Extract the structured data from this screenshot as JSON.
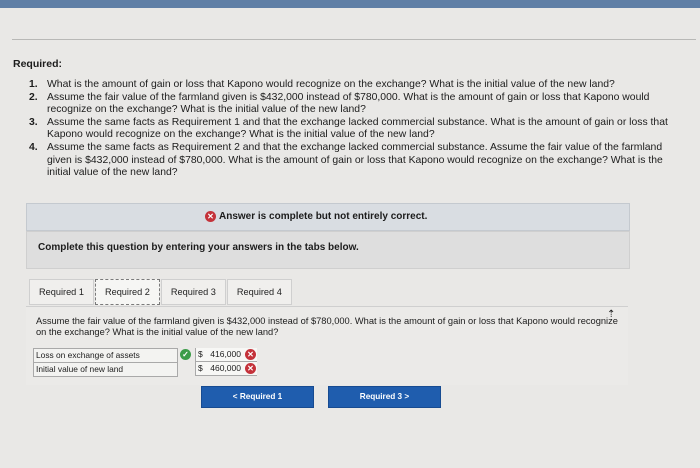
{
  "header": {
    "required_title": "Required:"
  },
  "questions": [
    {
      "num": "1.",
      "text": "What is the amount of gain or loss that Kapono would recognize on the exchange? What is the initial value of the new land?"
    },
    {
      "num": "2.",
      "text": "Assume the fair value of the farmland given is $432,000 instead of $780,000. What is the amount of gain or loss that Kapono would recognize on the exchange? What is the initial value of the new land?"
    },
    {
      "num": "3.",
      "text": "Assume the same facts as Requirement 1 and that the exchange lacked commercial substance. What is the amount of gain or loss that Kapono would recognize on the exchange? What is the initial value of the new land?"
    },
    {
      "num": "4.",
      "text": "Assume the same facts as Requirement 2 and that the exchange lacked commercial substance. Assume the fair value of the farmland given is $432,000 instead of $780,000. What is the amount of gain or loss that Kapono would recognize on the exchange? What is the initial value of the new land?"
    }
  ],
  "answer_status": "Answer is complete but not entirely correct.",
  "complete_prompt": "Complete this question by entering your answers in the tabs below.",
  "tabs": [
    {
      "label": "Required 1"
    },
    {
      "label": "Required 2"
    },
    {
      "label": "Required 3"
    },
    {
      "label": "Required 4"
    }
  ],
  "active_tab": "Required 2",
  "panel_question": "Assume the fair value of the farmland given is $432,000 instead of $780,000. What is the amount of gain or loss that Kapono would recognize on the exchange? What is the initial value of the new land?",
  "answers": [
    {
      "label": "Loss on exchange of assets",
      "currency": "$",
      "value": "416,000",
      "row_correct": true,
      "value_correct": false
    },
    {
      "label": "Initial value of new land",
      "currency": "$",
      "value": "460,000",
      "value_correct": false
    }
  ],
  "nav": {
    "prev_label": "Required 1",
    "prev_glyph": "<",
    "next_label": "Required 3",
    "next_glyph": ">"
  },
  "colors": {
    "accent_blue": "#1f5dae",
    "error_red": "#c4323a",
    "success_green": "#3c9c48"
  }
}
